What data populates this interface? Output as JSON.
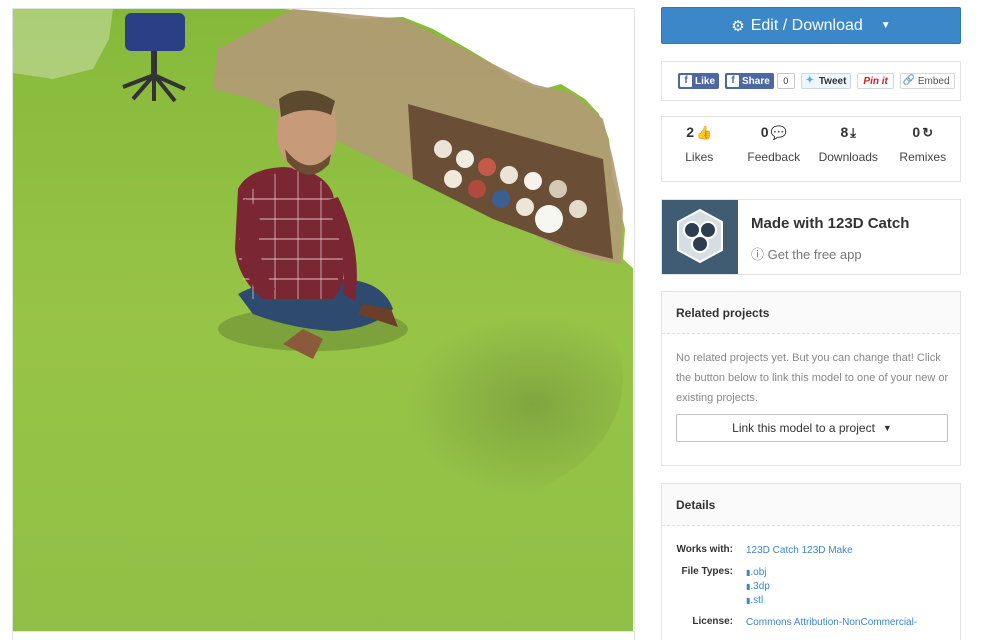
{
  "viewer": {
    "subject": "3D scan of a man sitting cross-legged on green carpet"
  },
  "actions": {
    "edit_download_label": "Edit / Download",
    "gear_icon": "gear-icon",
    "caret_icon": "caret-down-icon"
  },
  "share": {
    "like_label": "Like",
    "share_label": "Share",
    "share_count": "0",
    "tweet_label": "Tweet",
    "pinit_label": "Pin it",
    "embed_label": "Embed"
  },
  "stats": [
    {
      "value": "2",
      "label": "Likes",
      "icon": "thumbs-up-icon"
    },
    {
      "value": "0",
      "label": "Feedback",
      "icon": "comment-icon"
    },
    {
      "value": "8",
      "label": "Downloads",
      "icon": "download-icon"
    },
    {
      "value": "0",
      "label": "Remixes",
      "icon": "remix-icon"
    }
  ],
  "catch": {
    "title": "Made with 123D Catch",
    "subtitle": "Get the free app"
  },
  "related": {
    "title": "Related projects",
    "text": "No related projects yet. But you can change that! Click the button below to link this model to one of your new or existing projects.",
    "link_label": "Link this model to a project"
  },
  "details": {
    "title": "Details",
    "works_with_label": "Works with:",
    "works_with_value": "123D Catch 123D Make",
    "file_types_label": "File Types:",
    "file_types": [
      ".obj",
      ".3dp",
      ".stl"
    ],
    "license_label": "License:",
    "license_value": "Commons Attribution-NonCommercial-"
  },
  "colors": {
    "primary": "#3b87c8",
    "carpet": "#8fbf3c",
    "facebook": "#4c67a1"
  }
}
